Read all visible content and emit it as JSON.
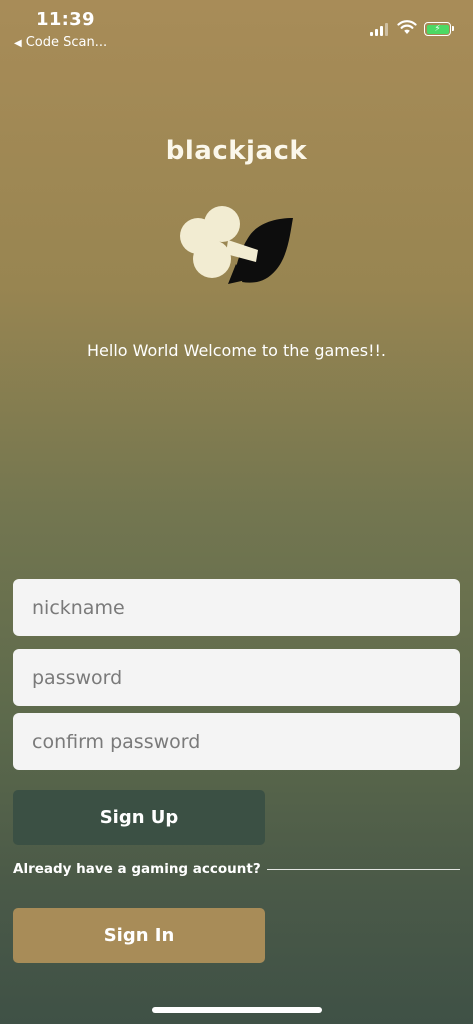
{
  "status_bar": {
    "time": "11:39",
    "back_app_label": "Code Scan...",
    "back_glyph": "◀",
    "battery_glyph": "⚡",
    "icons": [
      "signal-icon",
      "wifi-icon",
      "battery-icon"
    ],
    "battery_color": "#4cd964"
  },
  "app": {
    "title": "blackjack",
    "logo": "club-and-spade-logo",
    "welcome": "Hello World Welcome to the games!!."
  },
  "form": {
    "nickname_placeholder": "nickname",
    "password_placeholder": "password",
    "confirm_placeholder": "confirm password",
    "signup_label": "Sign Up",
    "already_text": "Already have a gaming account?",
    "signin_label": "Sign In"
  },
  "colors": {
    "background_top": "#a88c58",
    "background_bottom": "#3f5146",
    "signup_button": "#3b5044",
    "signin_button": "#a88c58",
    "input_background": "#f4f4f4",
    "title_color": "#fbf7ea"
  }
}
